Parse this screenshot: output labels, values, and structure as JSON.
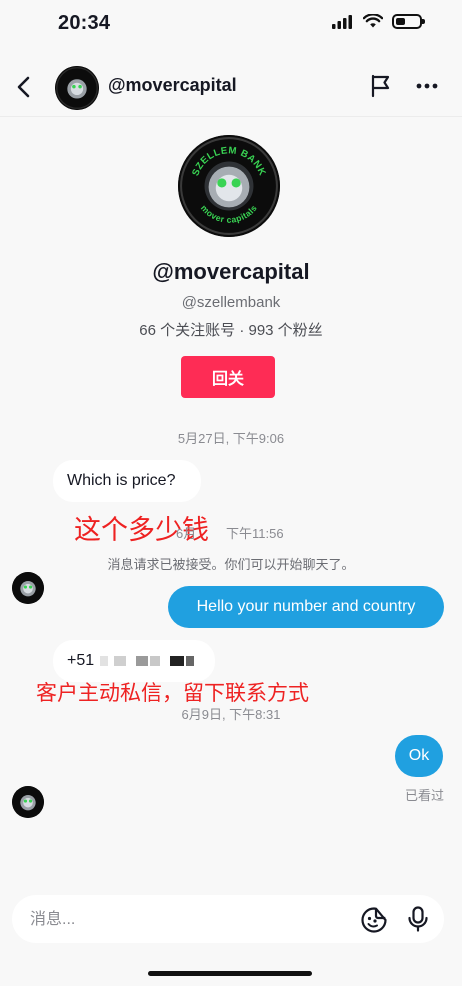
{
  "status_bar": {
    "time": "20:34",
    "battery_level": 0.35
  },
  "header": {
    "username": "@movercapital",
    "back_icon": "chevron-left-icon",
    "flag_icon": "flag-icon",
    "more_icon": "more-horizontal-icon"
  },
  "avatar_logo": {
    "top_text": "SZELLEM BANK",
    "bottom_text": "mover capitals"
  },
  "profile": {
    "name": "@movercapital",
    "handle": "@szellembank",
    "stats": "66 个关注账号 · 993 个粉丝",
    "follow_back_label": "回关"
  },
  "messages": {
    "timestamp_1": "5月27日, 下午9:06",
    "msg_1": "Which is price?",
    "annotation_1": "这个多少钱",
    "timestamp_2_prefix": "6月",
    "timestamp_2_suffix": "下午11:56",
    "system_note": "消息请求已被接受。你们可以开始聊天了。",
    "msg_2": "Hello your number and country",
    "msg_3_prefix": "+51",
    "annotation_2": "客户主动私信，留下联系方式",
    "timestamp_3": "6月9日, 下午8:31",
    "msg_4": "Ok",
    "seen_label": "已看过"
  },
  "input": {
    "placeholder": "消息...",
    "emoji_icon": "emoji-sticker-icon",
    "mic_icon": "microphone-icon"
  },
  "colors": {
    "follow_button": "#fe2c55",
    "outgoing_bubble": "#20a0e0",
    "annotation": "#ee2222",
    "logo_green": "#39d353"
  }
}
